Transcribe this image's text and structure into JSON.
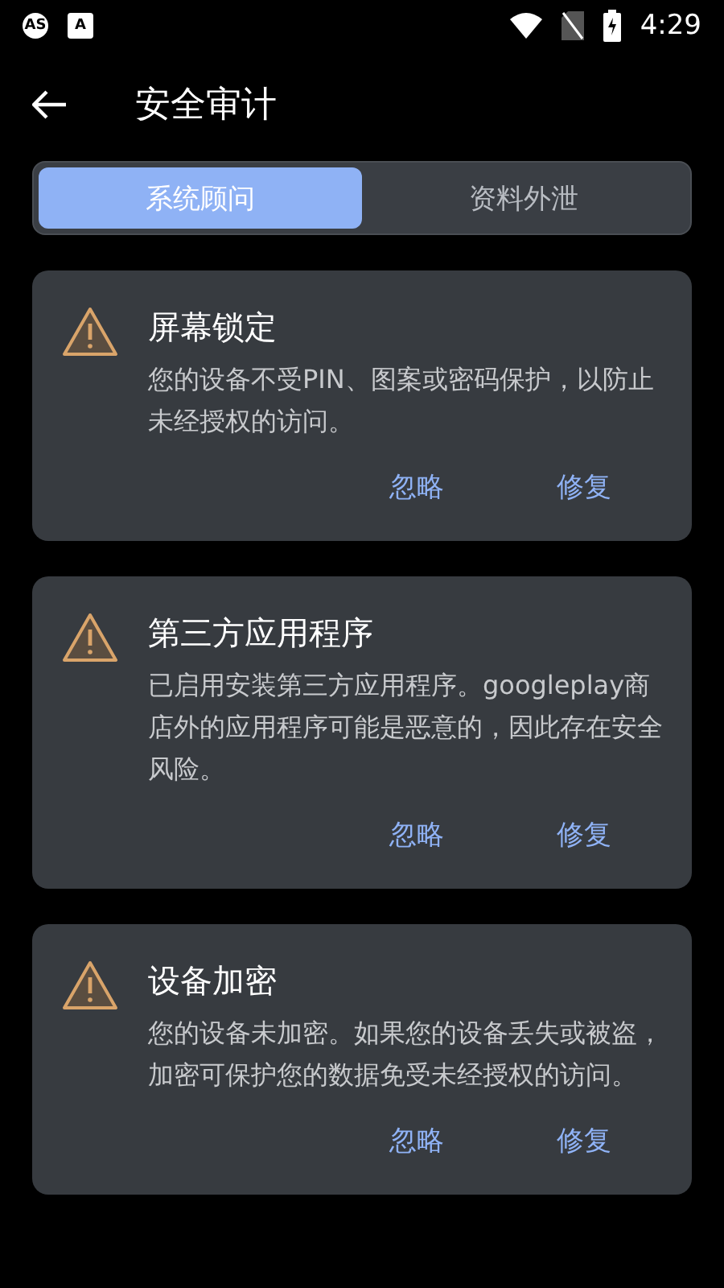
{
  "status_bar": {
    "badges": [
      "AS",
      "A"
    ],
    "time": "4:29"
  },
  "header": {
    "title": "安全审计"
  },
  "tabs": [
    {
      "label": "系统顾问",
      "selected": true
    },
    {
      "label": "资料外泄",
      "selected": false
    }
  ],
  "cards": [
    {
      "title": "屏幕锁定",
      "body": "您的设备不受PIN、图案或密码保护，以防止未经授权的访问。",
      "actions": [
        "忽略",
        "修复"
      ]
    },
    {
      "title": "第三方应用程序",
      "body": "已启用安装第三方应用程序。googleplay商店外的应用程序可能是恶意的，因此存在安全风险。",
      "actions": [
        "忽略",
        "修复"
      ]
    },
    {
      "title": "设备加密",
      "body": "您的设备未加密。如果您的设备丢失或被盗，加密可保护您的数据免受未经授权的访问。",
      "actions": [
        "忽略",
        "修复"
      ]
    }
  ]
}
